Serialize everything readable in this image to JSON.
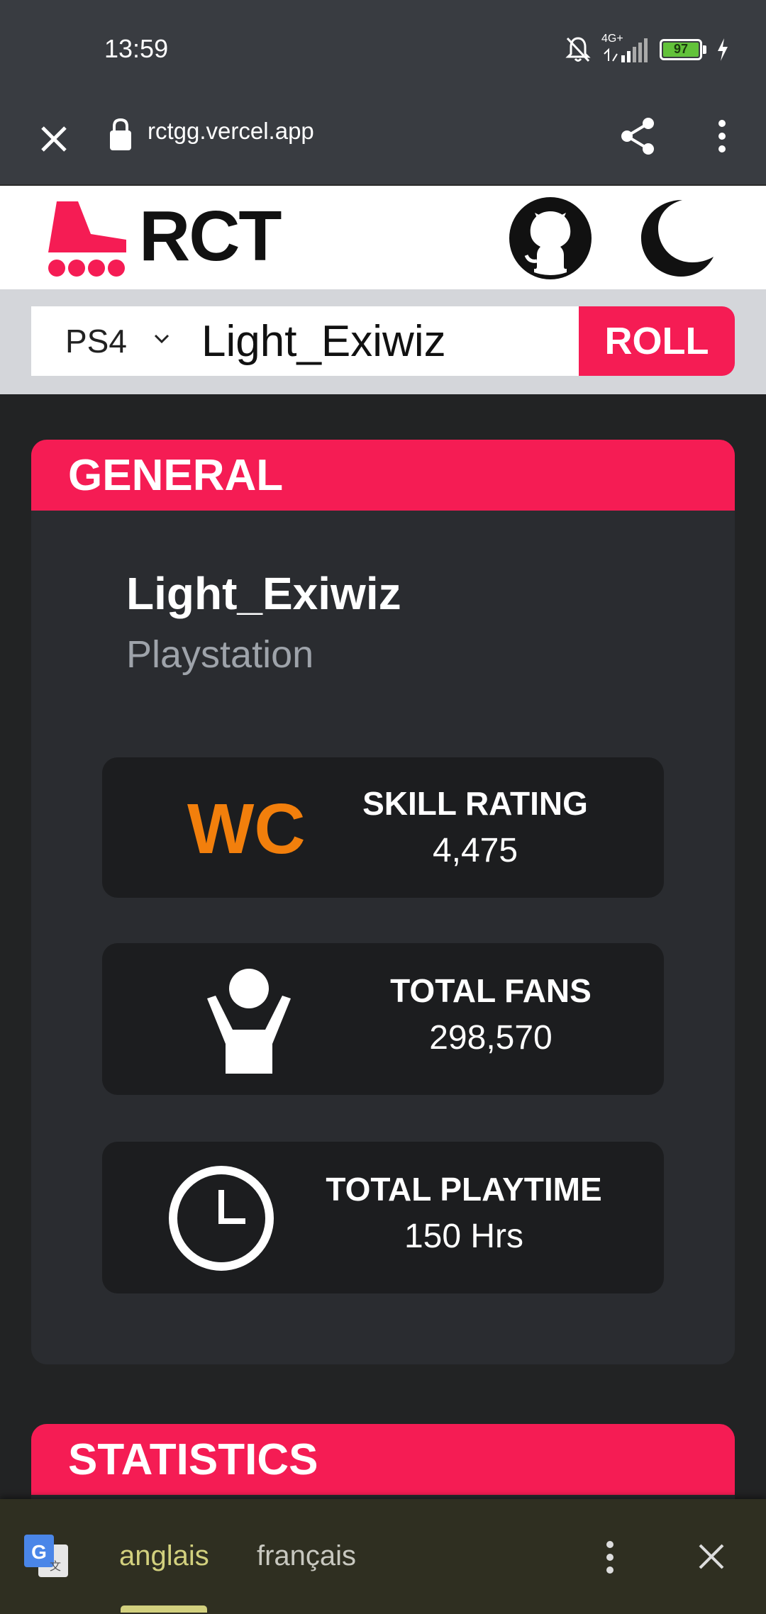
{
  "status_bar": {
    "time": "13:59",
    "network": "4G+",
    "battery": "97"
  },
  "browser": {
    "url": "rctgg.vercel.app",
    "icons": [
      "close-icon",
      "lock-icon",
      "share-icon",
      "more-vert-icon"
    ]
  },
  "site": {
    "logo_text": "RCT",
    "accent_color": "#f51c54",
    "icons": [
      "rollerskate-logo-icon",
      "github-icon",
      "moon-icon"
    ]
  },
  "search": {
    "platform": "PS4",
    "username": "Light_Exiwiz",
    "button": "ROLL"
  },
  "general": {
    "header": "GENERAL",
    "player_name": "Light_Exiwiz",
    "platform_name": "Playstation",
    "skill": {
      "badge": "WC",
      "label": "SKILL RATING",
      "value": "4,475",
      "badge_color": "#f27f0c"
    },
    "fans": {
      "label": "TOTAL FANS",
      "value": "298,570",
      "icon": "person-cheering-icon"
    },
    "playtime": {
      "label": "TOTAL PLAYTIME",
      "value": "150 Hrs",
      "icon": "clock-icon"
    }
  },
  "statistics": {
    "header": "STATISTICS"
  },
  "translate": {
    "source_lang": "anglais",
    "target_lang": "français",
    "icons": [
      "google-translate-icon",
      "more-vert-icon",
      "close-icon"
    ]
  }
}
